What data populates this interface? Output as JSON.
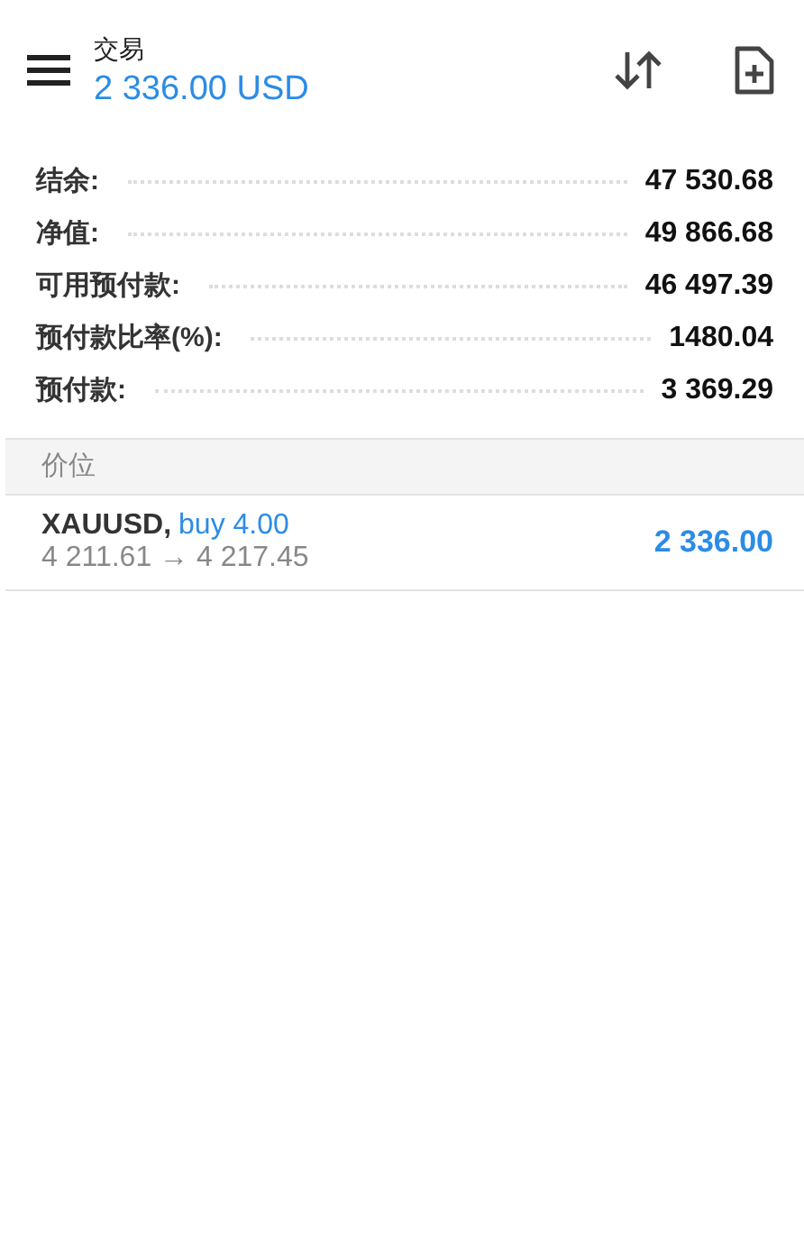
{
  "header": {
    "title": "交易",
    "balance": "2 336.00 USD"
  },
  "summary": [
    {
      "label": "结余:",
      "value": "47 530.68"
    },
    {
      "label": "净值:",
      "value": "49 866.68"
    },
    {
      "label": "可用预付款:",
      "value": "46 497.39"
    },
    {
      "label": "预付款比率(%):",
      "value": "1480.04"
    },
    {
      "label": "预付款:",
      "value": "3 369.29"
    }
  ],
  "section": {
    "title": "价位"
  },
  "positions": [
    {
      "symbol": "XAUUSD,",
      "side": "buy",
      "volume": "4.00",
      "prices": "4 211.61 → 4 217.45",
      "profit": "2 336.00"
    }
  ]
}
